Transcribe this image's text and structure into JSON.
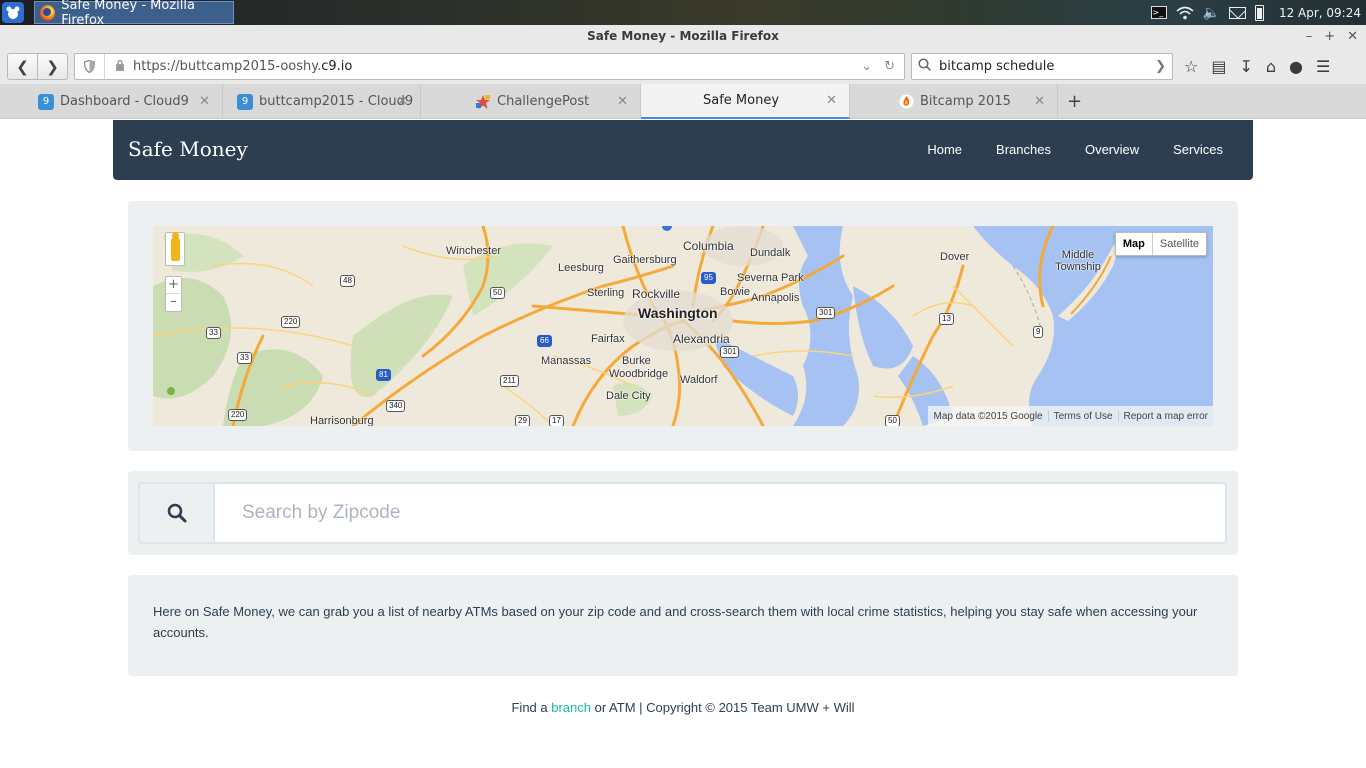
{
  "os": {
    "window_task_title": "Safe Money - Mozilla Firefox",
    "clock": "12 Apr, 09:24"
  },
  "browser": {
    "title": "Safe Money - Mozilla Firefox",
    "url_prefix": "https://buttcamp2015-ooshy.",
    "url_domain": "c9.io",
    "search_value": "bitcamp schedule",
    "tabs": [
      {
        "title": "Dashboard - Cloud9",
        "active": false
      },
      {
        "title": "buttcamp2015 - Cloud9",
        "active": false
      },
      {
        "title": "ChallengePost",
        "active": false
      },
      {
        "title": "Safe Money",
        "active": true
      },
      {
        "title": "Bitcamp 2015",
        "active": false
      }
    ]
  },
  "site": {
    "brand": "Safe Money",
    "nav": [
      "Home",
      "Branches",
      "Overview",
      "Services"
    ]
  },
  "map": {
    "type_buttons": [
      "Map",
      "Satellite"
    ],
    "attribution": [
      "Map data ©2015 Google",
      "Terms of Use",
      "Report a map error"
    ],
    "cities": [
      "Winchester",
      "Columbia",
      "Dundalk",
      "Gaithersburg",
      "Leesburg",
      "Severna Park",
      "Dover",
      "Middle Township",
      "Sterling",
      "Rockville",
      "Bowie",
      "Annapolis",
      "Washington",
      "Fairfax",
      "Alexandria",
      "Manassas",
      "Burke",
      "Woodbridge",
      "Waldorf",
      "Dale City",
      "Harrisonburg"
    ],
    "route_shields": [
      "48",
      "220",
      "33",
      "33",
      "50",
      "95",
      "66",
      "211",
      "81",
      "340",
      "220",
      "29",
      "17",
      "301",
      "301",
      "13",
      "9",
      "50"
    ]
  },
  "search": {
    "placeholder": "Search by Zipcode",
    "icon": "search-icon"
  },
  "info": {
    "text": "Here on Safe Money, we can grab you a list of nearby ATMs based on your zip code and and cross-search them with local crime statistics, helping you stay safe when accessing your accounts."
  },
  "footer": {
    "prefix": "Find a ",
    "link": "branch",
    "suffix": " or ATM | Copyright © 2015 Team UMW + Will"
  },
  "colors": {
    "navbar": "#2c3e50",
    "well": "#ecf0f1",
    "link": "#18bc9c",
    "water": "#a5c2f2",
    "land": "#efe9dc",
    "forest": "#c9dcb2",
    "highway": "#f4a93a"
  }
}
